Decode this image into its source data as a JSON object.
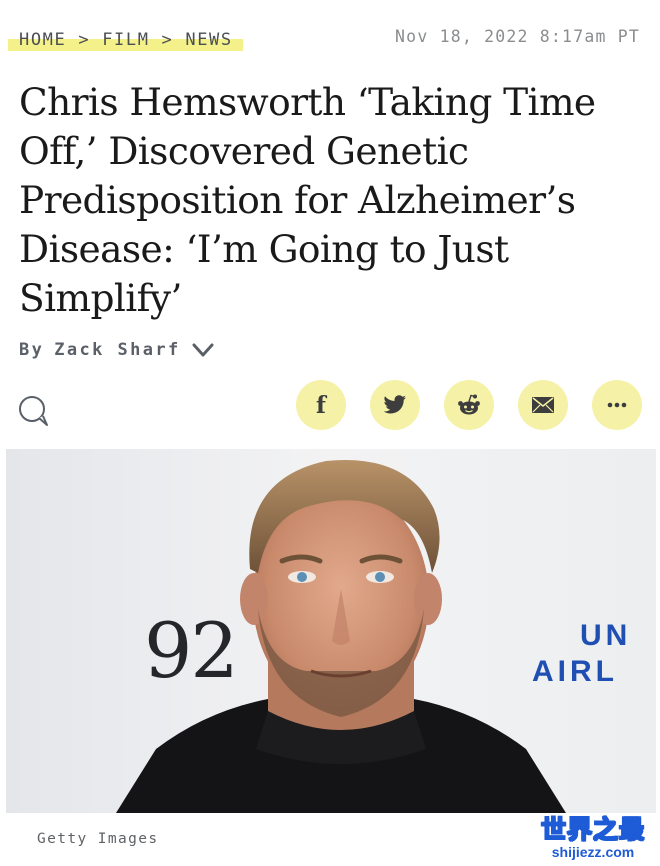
{
  "breadcrumb": {
    "items": [
      "HOME",
      "FILM",
      "NEWS"
    ],
    "separator": ">"
  },
  "timestamp": "Nov 18, 2022 8:17am PT",
  "headline": "Chris Hemsworth ‘Taking Time Off,’ Discovered Genetic Predisposition for Alzheimer’s Disease: ‘I’m Going to Just Simplify’",
  "byline": {
    "prefix": "By",
    "author": "Zack Sharf",
    "toggle_icon": "chevron-down-icon"
  },
  "share": {
    "comment_icon": "comment-bubble-icon",
    "buttons": [
      {
        "name": "facebook",
        "icon": "facebook-icon"
      },
      {
        "name": "twitter",
        "icon": "twitter-icon"
      },
      {
        "name": "reddit",
        "icon": "reddit-icon"
      },
      {
        "name": "email",
        "icon": "email-icon"
      },
      {
        "name": "more",
        "icon": "more-icon"
      }
    ],
    "button_color": "#f5f1a7"
  },
  "hero_image": {
    "backdrop_text_left": "92",
    "backdrop_text_right_line1": "UN",
    "backdrop_text_right_line2": "AIRL",
    "caption": "Getty Images"
  },
  "watermark": {
    "text": "世界之最",
    "url": "shijiezz.com"
  },
  "colors": {
    "highlight": "#f4f08a",
    "share_button": "#f5f1a7",
    "watermark_blue": "#1e5bd6"
  }
}
